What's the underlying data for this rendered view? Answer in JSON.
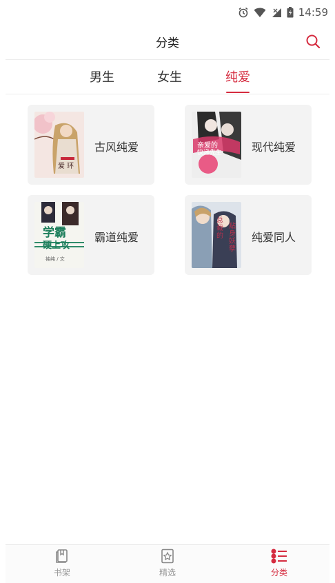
{
  "status_bar": {
    "time": "14:59"
  },
  "header": {
    "title": "分类"
  },
  "tabs": [
    {
      "label": "男生"
    },
    {
      "label": "女生"
    },
    {
      "label": "纯爱"
    }
  ],
  "active_tab": "纯爱",
  "categories": [
    {
      "label": "古风纯爱",
      "cover_icon": "book-cover-ancient"
    },
    {
      "label": "现代纯爱",
      "cover_icon": "book-cover-modern"
    },
    {
      "label": "霸道纯爱",
      "cover_icon": "book-cover-domineering"
    },
    {
      "label": "纯爱同人",
      "cover_icon": "book-cover-fanfic"
    }
  ],
  "cover_text": {
    "ancient": "爱 环",
    "modern_line1": "亲爱的",
    "modern_line2": "快递先生",
    "domineering_line1": "学霸",
    "domineering_line2": "硬上攻",
    "domineering_author": "袖纯 / 文",
    "fanfic_line1": "总裁的",
    "fanfic_line2": "贴身妖孽"
  },
  "bottom_nav": [
    {
      "label": "书架",
      "icon": "bookshelf-icon"
    },
    {
      "label": "精选",
      "icon": "star-bookmark-icon"
    },
    {
      "label": "分类",
      "icon": "category-list-icon"
    }
  ],
  "colors": {
    "accent": "#d52b3f",
    "card_bg": "#f3f3f3",
    "text": "#333333",
    "muted": "#999999"
  }
}
